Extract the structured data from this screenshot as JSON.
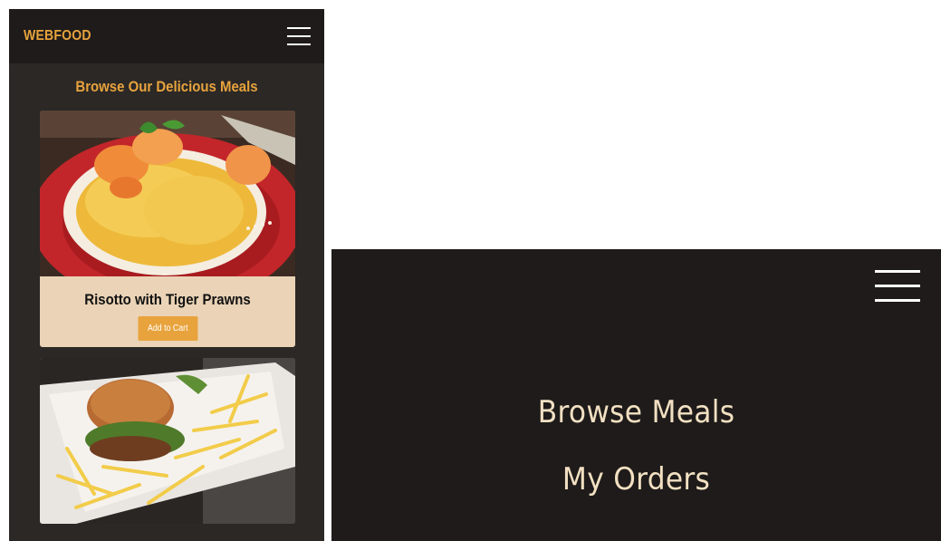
{
  "app": {
    "brand": "WEBFOOD"
  },
  "page": {
    "heading": "Browse Our Delicious Meals"
  },
  "meals": [
    {
      "name": "Risotto with Tiger Prawns",
      "button_label": "Add to Cart",
      "image": "risotto-with-prawns-photo"
    },
    {
      "name": "",
      "button_label": "",
      "image": "burger-with-fries-photo"
    }
  ],
  "menu": {
    "items": [
      {
        "label": "Browse Meals"
      },
      {
        "label": "My Orders"
      }
    ]
  },
  "colors": {
    "accent": "#e8a33d",
    "header_bg": "#1e1b1a",
    "page_bg": "#2b2826",
    "card_bg": "#ead3b6",
    "menu_text": "#f2e0c2"
  },
  "icons": {
    "menu": "hamburger-icon",
    "menu_open": "hamburger-icon"
  }
}
